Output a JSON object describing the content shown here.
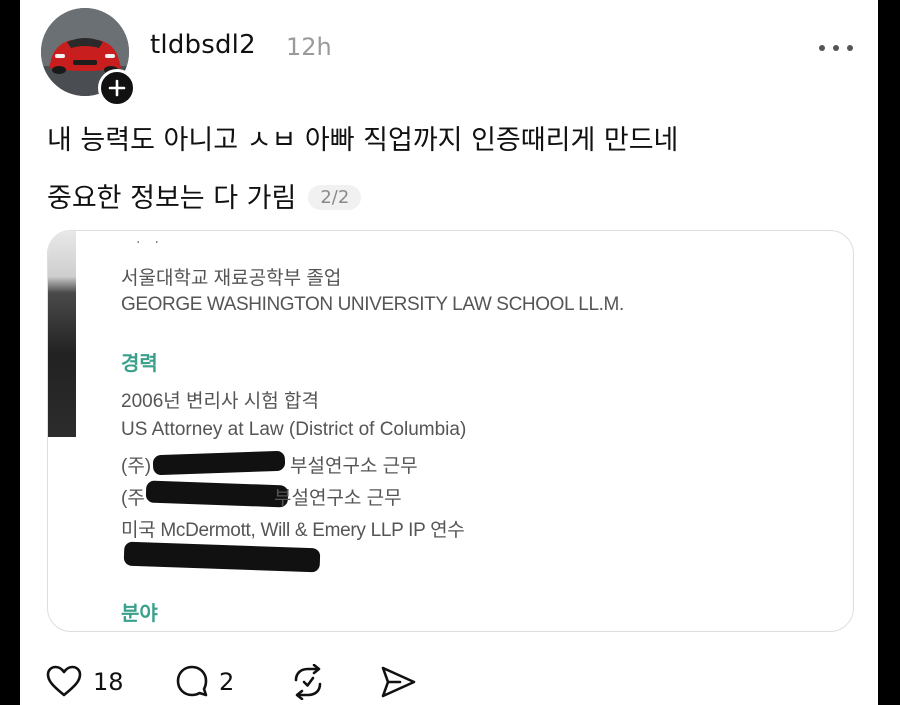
{
  "post": {
    "username": "tldbsdl2",
    "time": "12h",
    "text_line1": "내 능력도 아니고 ㅅㅂ 아빠 직업까지 인증때리게 만드네",
    "text_line2": "중요한 정보는 다 가림",
    "page_indicator": "2/2"
  },
  "card": {
    "edu_line1": "서울대학교 재료공학부 졸업",
    "edu_line2": "GEORGE WASHINGTON UNIVERSITY LAW SCHOOL LL.M.",
    "career_heading": "경력",
    "career_items": [
      "2006년 변리사 시험 합격",
      "US Attorney at Law (District of Columbia)",
      "(주)",
      "부설연구소 근무",
      "(주",
      "부설연구소 근무",
      "미국 McDermott, Will & Emery LLP IP 연수"
    ],
    "field_heading": "분야"
  },
  "actions": {
    "likes": "18",
    "comments": "2"
  },
  "icons": {
    "avatar": "red-sports-car-avatar",
    "add": "plus-icon",
    "more": "more-dots-icon",
    "like": "heart-icon",
    "comment": "comment-bubble-icon",
    "repost": "repost-icon",
    "share": "send-icon"
  },
  "colors": {
    "accent_heading": "#3aa08c",
    "muted": "#9a9a9a"
  }
}
